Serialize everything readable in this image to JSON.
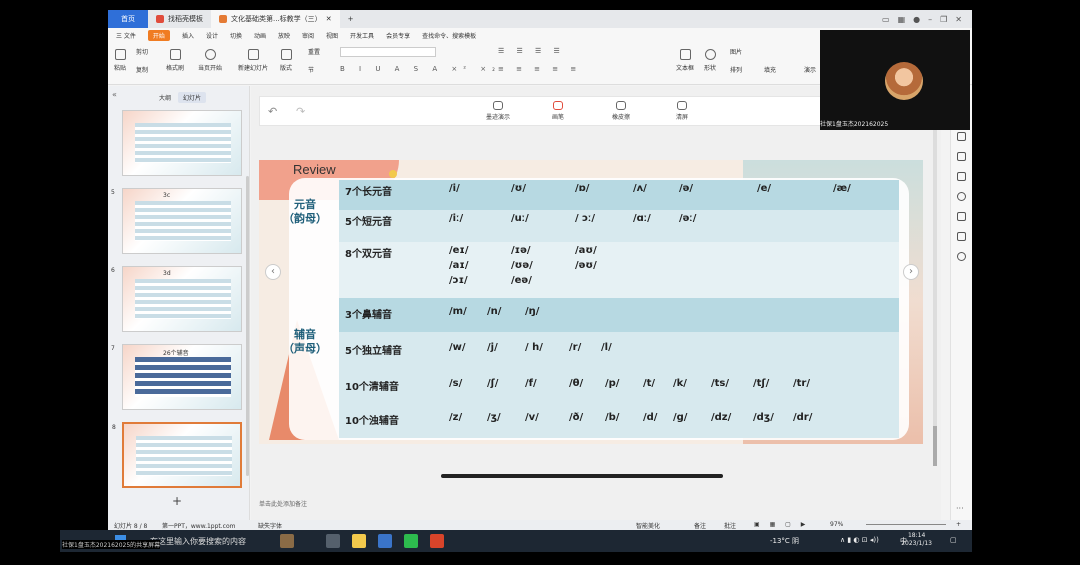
{
  "tabs": [
    {
      "label": "首页"
    },
    {
      "label": "找稻壳模板"
    },
    {
      "label": "文化基础类第...标教学（三）"
    }
  ],
  "menu": [
    "三 文件",
    "开始",
    "插入",
    "设计",
    "切换",
    "动画",
    "放映",
    "审阅",
    "视图",
    "开发工具",
    "会员专享",
    "查找命令、搜索模板"
  ],
  "ribbon": {
    "paste": "粘贴",
    "cut": "剪切",
    "copy": "复制",
    "format_painter": "格式刷",
    "play_from": "当页开始",
    "new_slide": "新建幻灯片",
    "layout": "版式",
    "section": "节",
    "reset": "重置",
    "textbox": "文本框",
    "shape": "形状",
    "arrange": "排列",
    "picture": "图片",
    "fill": "填充",
    "present": "演示"
  },
  "left_panel": {
    "tab_outline": "大纲",
    "tab_slides": "幻灯片",
    "thumb_numbers": [
      "5",
      "6",
      "7",
      "8"
    ],
    "thumb_titles": [
      "3c",
      "3d",
      "26个辅音",
      ""
    ],
    "add_label": "+"
  },
  "pen_tools": [
    "墨迹演示",
    "画笔",
    "橡皮擦",
    "清屏"
  ],
  "slide": {
    "review": "Review",
    "vowel_label": "元音\n（韵母）",
    "consonant_label": "辅音\n（声母）",
    "rows": [
      {
        "label": "7个长元音",
        "cells": [
          "/i/",
          "/ʊ/",
          "/ɒ/",
          "/ʌ/",
          "/ə/",
          "/e/",
          "/æ/"
        ]
      },
      {
        "label": "5个短元音",
        "cells": [
          "/iː/",
          "/uː/",
          "/ ɔː/",
          "/ɑː/",
          "/əː/"
        ]
      },
      {
        "label": "8个双元音",
        "cells": [
          "/eɪ/",
          "/ɪə/",
          "/aʊ/",
          "/aɪ/",
          "/ʊə/",
          "/əʊ/",
          "/ɔɪ/",
          "/eə/"
        ]
      },
      {
        "label": "3个鼻辅音",
        "cells": [
          "/m/",
          "/n/",
          "/ŋ/"
        ]
      },
      {
        "label": "5个独立辅音",
        "cells": [
          "/w/",
          "/j/",
          "/ h/",
          "/r/",
          "/l/"
        ]
      },
      {
        "label": "10个清辅音",
        "cells": [
          "/s/",
          "/ʃ/",
          "/f/",
          "/θ/",
          "/p/",
          "/t/",
          "/k/",
          "/ts/",
          "/tʃ/",
          "/tr/"
        ]
      },
      {
        "label": "10个浊辅音",
        "cells": [
          "/z/",
          "/ʒ/",
          "/v/",
          "/ð/",
          "/b/",
          "/d/",
          "/g/",
          "/dz/",
          "/dʒ/",
          "/dr/"
        ]
      }
    ]
  },
  "notes_placeholder": "单击此处添加备注",
  "status": {
    "slide_pos": "幻灯片 8 / 8",
    "theme": "第一PPT，www.1ppt.com",
    "font_missing": "缺失字体",
    "smart": "智能美化",
    "notes": "备注",
    "comments": "批注",
    "zoom": "97%"
  },
  "video": {
    "name": "社保1盘玉杰202162025"
  },
  "taskbar": {
    "search": "在这里输入你要搜索的内容",
    "weather": "-13°C 阴",
    "ime": "中",
    "time": "18:14",
    "date": "2023/1/13"
  },
  "caption": "社保1盘玉杰202162025的共享屏幕"
}
